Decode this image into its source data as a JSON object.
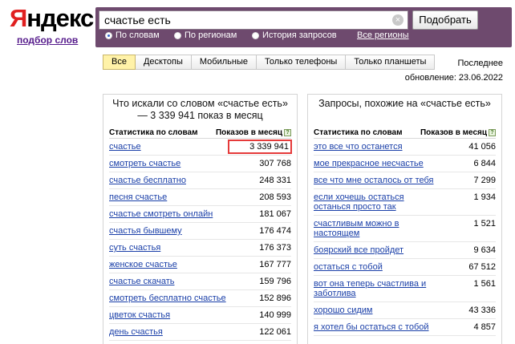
{
  "header": {
    "logo_first": "Я",
    "logo_rest": "ндекс",
    "sublink": "подбор слов"
  },
  "search": {
    "query": "счастье есть",
    "clear": "×",
    "submit_label": "Подобрать",
    "modes": [
      {
        "label": "По словам",
        "selected": true
      },
      {
        "label": "По регионам",
        "selected": false
      },
      {
        "label": "История запросов",
        "selected": false
      }
    ],
    "regions_link": "Все регионы"
  },
  "tabs": [
    "Все",
    "Десктопы",
    "Мобильные",
    "Только телефоны",
    "Только планшеты"
  ],
  "active_tab": "Все",
  "updated": {
    "line1": "Последнее",
    "line2": "обновление: 23.06.2022"
  },
  "left_panel": {
    "title": "Что искали со словом «счастье есть» — 3 339 941 показ в месяц",
    "col_keyword": "Статистика по словам",
    "col_count": "Показов в месяц",
    "help": "?",
    "rows": [
      {
        "kw": "счастье",
        "n": "3 339 941"
      },
      {
        "kw": "смотреть счастье",
        "n": "307 768"
      },
      {
        "kw": "счастье бесплатно",
        "n": "248 331"
      },
      {
        "kw": "песня счастье",
        "n": "208 593"
      },
      {
        "kw": "счастье смотреть онлайн",
        "n": "181 067"
      },
      {
        "kw": "счастья бывшему",
        "n": "176 474"
      },
      {
        "kw": "суть счастья",
        "n": "176 373"
      },
      {
        "kw": "женское счастье",
        "n": "167 777"
      },
      {
        "kw": "счастье скачать",
        "n": "159 796"
      },
      {
        "kw": "смотреть бесплатно счастье",
        "n": "152 896"
      },
      {
        "kw": "цветок счастья",
        "n": "140 999"
      },
      {
        "kw": "день счастья",
        "n": "122 061"
      }
    ]
  },
  "right_panel": {
    "title": "Запросы, похожие на «счастье есть»",
    "col_keyword": "Статистика по словам",
    "col_count": "Показов в месяц",
    "help": "?",
    "rows": [
      {
        "kw": "это все что останется",
        "n": "41 056"
      },
      {
        "kw": "мое прекрасное несчастье",
        "n": "6 844"
      },
      {
        "kw": "все что мне осталось от тебя",
        "n": "7 299"
      },
      {
        "kw": "если хочешь остаться останься просто так",
        "n": "1 934"
      },
      {
        "kw": "счастливым можно в настоящем",
        "n": "1 521"
      },
      {
        "kw": "боярский все пройдет",
        "n": "9 634"
      },
      {
        "kw": "остаться с тобой",
        "n": "67 512"
      },
      {
        "kw": "вот она теперь счастлива и заботлива",
        "n": "1 561"
      },
      {
        "kw": "хорошо сидим",
        "n": "43 336"
      },
      {
        "kw": "я хотел бы остаться с тобой",
        "n": "4 857"
      }
    ]
  }
}
